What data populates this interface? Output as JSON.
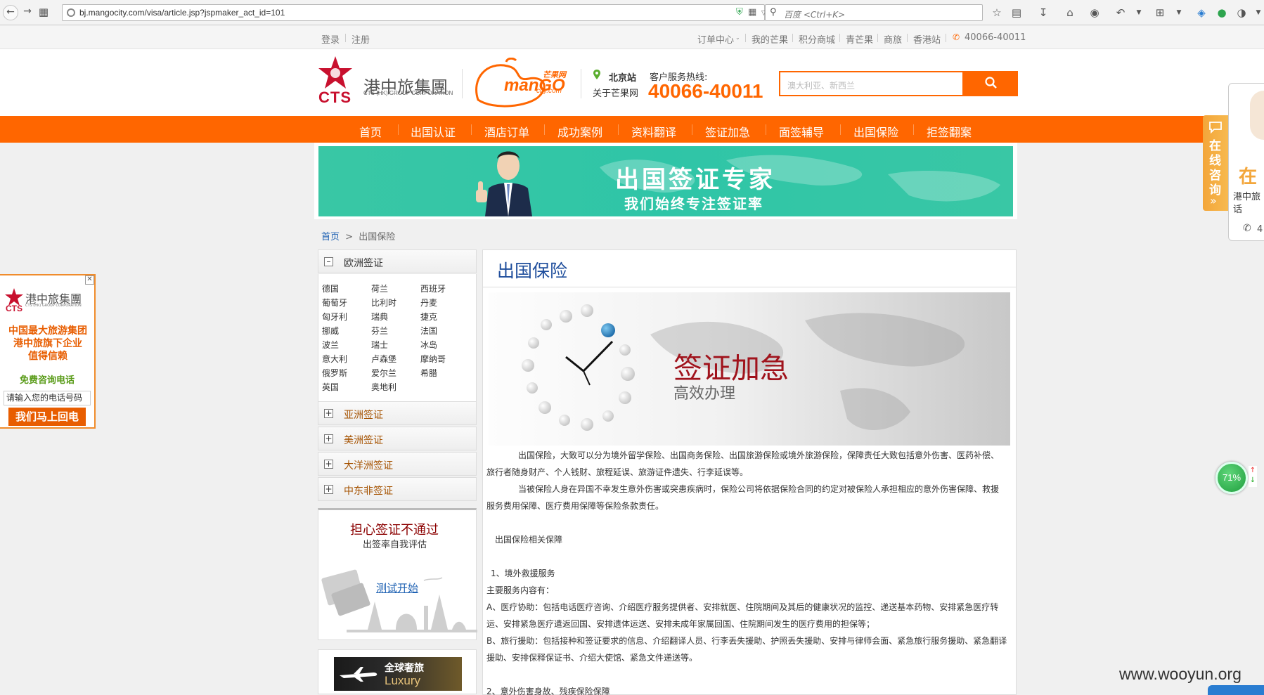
{
  "browser": {
    "url": "bj.mangocity.com/visa/article.jsp?jspmaker_act_id=101",
    "search_placeholder": "百度 <Ctrl+K>"
  },
  "utility": {
    "login": "登录",
    "register": "注册",
    "links": [
      "订单中心",
      "我的芒果",
      "积分商城",
      "青芒果",
      "商旅",
      "香港站"
    ],
    "phone": "40066-40011"
  },
  "header": {
    "cts_cn": "港中旅集團",
    "cts_en": "CTS (HK) GROUP CORPORATION",
    "cts_word": "CTS",
    "mango_cn": "芒果网",
    "mango_en": "manGO",
    "mango_com": "city.com",
    "station": "北京站",
    "about": "关于芒果网",
    "hotline_label": "客户服务热线:",
    "hotline": "40066-40011",
    "search_placeholder": "澳大利亚、新西兰"
  },
  "nav": [
    "首页",
    "出国认证",
    "酒店订单",
    "成功案例",
    "资料翻译",
    "签证加急",
    "面签辅导",
    "出国保险",
    "拒签翻案"
  ],
  "banner": {
    "title": "出国签证专家",
    "subtitle": "我们始终专注签证率"
  },
  "breadcrumb": {
    "home": "首页",
    "sep": ">",
    "current": "出国保险"
  },
  "sidebar": {
    "europe": "欧洲签证",
    "countries": [
      "德国",
      "荷兰",
      "西班牙",
      "葡萄牙",
      "比利时",
      "丹麦",
      "匈牙利",
      "瑞典",
      "捷克",
      "挪威",
      "芬兰",
      "法国",
      "波兰",
      "瑞士",
      "冰岛",
      "意大利",
      "卢森堡",
      "摩纳哥",
      "俄罗斯",
      "爱尔兰",
      "希腊",
      "英国",
      "奥地利"
    ],
    "asia": "亚洲签证",
    "america": "美洲签证",
    "oceania": "大洋洲签证",
    "mideast": "中东非签证",
    "promo_title": "担心签证不通过",
    "promo_sub": "出签率自我评估",
    "promo_link": "测试开始",
    "luxury_cn": "全球奢旅",
    "luxury_en": "Luxury"
  },
  "content": {
    "title": "出国保险",
    "hero_title": "签证加急",
    "hero_sub": "高效办理",
    "p1a": "出国保险，大致可以分为境外留学保险、出国商务保险、出国旅游保险或境外旅游保险，保障责任大致包括意外伤害、医药补偿、",
    "p1b": "旅行者随身财产、个人钱财、旅程延误、旅游证件遗失、行李延误等。",
    "p2a": "当被保险人身在异国不幸发生意外伤害或突患疾病时，保险公司将依据保险合同的约定对被保险人承担相应的意外伤害保障、救援",
    "p2b": "服务费用保障、医疗费用保障等保险条款责任。",
    "h1": "出国保险相关保障",
    "h2": "1、境外救援服务",
    "l1": "主要服务内容有：",
    "la1": "A、医疗协助：包括电话医疗咨询、介绍医疗服务提供者、安排就医、住院期间及其后的健康状况的监控、递送基本药物、安排紧急医疗转",
    "la2": "运、安排紧急医疗遣返回国、安排遗体运送、安排未成年家属回国、住院期间发生的医疗费用的担保等；",
    "lb1": "B、旅行援助：包括接种和签证要求的信息、介绍翻译人员、行李丢失援助、护照丢失援助、安排与律师会面、紧急旅行服务援助、紧急翻译",
    "lb2": "援助、安排保释保证书、介绍大使馆、紧急文件递送等。",
    "h3": "2、意外伤害身故、残疾保险保障"
  },
  "left_ad": {
    "cts_cn": "港中旅集團",
    "cts_en": "CTS (HK) GROUP CORPORATION",
    "cts_word": "CTS",
    "line1": "中国最大旅游集团",
    "line2": "港中旅旗下企业",
    "line3": "值得信赖",
    "free_call": "免费咨询电话",
    "input_ph": "请输入您的电话号码",
    "button": "我们马上回电",
    "close": "✕"
  },
  "right_float": {
    "consult": "在线咨询",
    "zai": "在",
    "r1": "港中旅",
    "r2": "话",
    "phone_digit": "4"
  },
  "gauge": "71%",
  "watermark": "www.wooyun.org"
}
